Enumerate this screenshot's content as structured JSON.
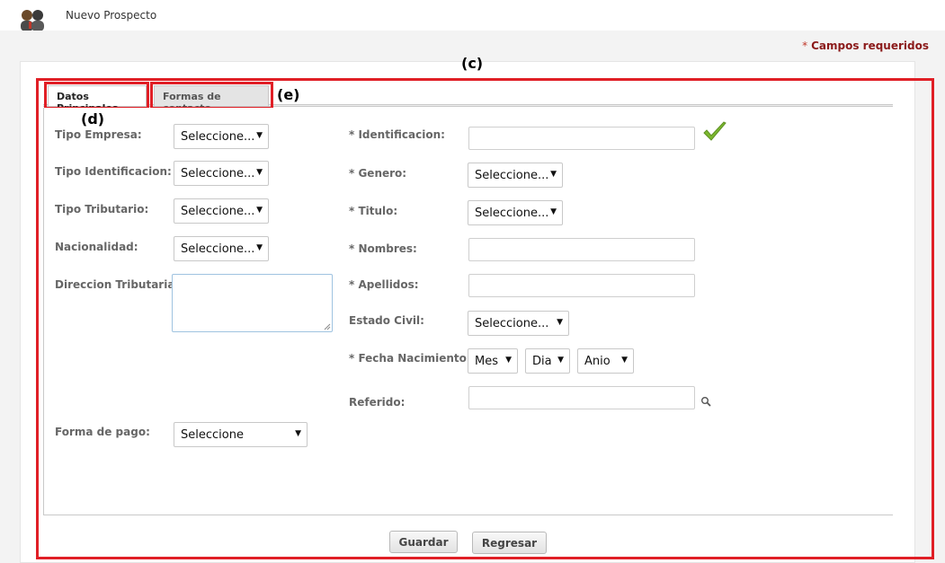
{
  "header": {
    "title": "Nuevo Prospecto",
    "icon": "user-hand-icon"
  },
  "required_note": {
    "star": "*",
    "text": "Campos requeridos"
  },
  "annotations": {
    "c": "(c)",
    "d": "(d)",
    "e": "(e)"
  },
  "tabs": [
    {
      "label": "Datos Principales",
      "active": true
    },
    {
      "label": "Formas de contacto",
      "active": false
    }
  ],
  "left_fields": {
    "tipo_empresa": {
      "label": "Tipo Empresa:",
      "value": "Seleccione..."
    },
    "tipo_identificacion": {
      "label": "Tipo Identificacion:",
      "value": "Seleccione..."
    },
    "tipo_tributario": {
      "label": "Tipo Tributario:",
      "value": "Seleccione..."
    },
    "nacionalidad": {
      "label": "Nacionalidad:",
      "value": "Seleccione..."
    },
    "direccion_tributaria": {
      "label": "Direccion Tributaria:",
      "value": ""
    },
    "forma_pago": {
      "label": "Forma de pago:",
      "value": "Seleccione"
    }
  },
  "right_fields": {
    "identificacion": {
      "label": "* Identificacion:",
      "value": ""
    },
    "genero": {
      "label": "* Genero:",
      "value": "Seleccione..."
    },
    "titulo": {
      "label": "* Titulo:",
      "value": "Seleccione..."
    },
    "nombres": {
      "label": "* Nombres:",
      "value": ""
    },
    "apellidos": {
      "label": "* Apellidos:",
      "value": ""
    },
    "estado_civil": {
      "label": "Estado Civil:",
      "value": "Seleccione..."
    },
    "fecha_nacimiento": {
      "label": "* Fecha Nacimiento:",
      "mes": "Mes",
      "dia": "Dia",
      "anio": "Anio"
    },
    "referido": {
      "label": "Referido:",
      "value": ""
    }
  },
  "buttons": {
    "guardar": "Guardar",
    "regresar": "Regresar"
  },
  "colors": {
    "annotation_red": "#e01f26",
    "required_text": "#8b1a1a",
    "check_green": "#7cb82f"
  }
}
